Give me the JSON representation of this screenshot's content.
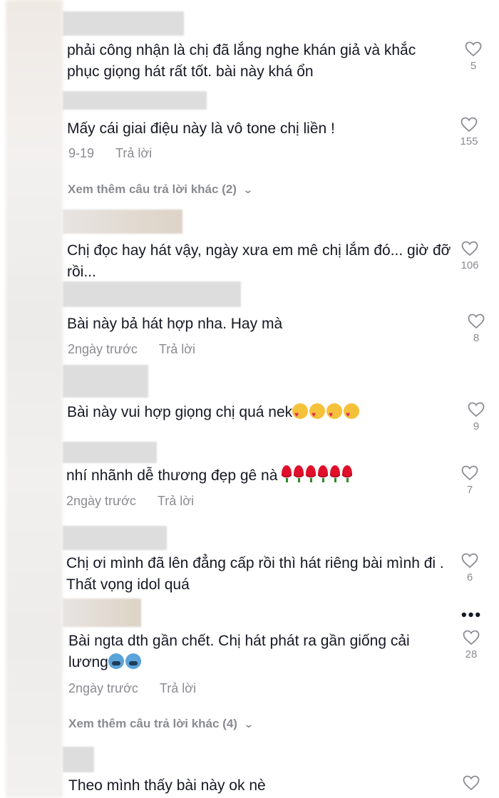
{
  "comments": [
    {
      "text": "phải công nhận là chị đã lắng nghe khán giả và khắc phục giọng hát rất tốt. bài này khá ổn",
      "likes": "5"
    },
    {
      "text": "Mấy cái giai điệu này là vô tone chị liền !",
      "date": "9-19",
      "reply": "Trả lời",
      "likes": "155",
      "more": "Xem thêm câu trả lời khác (2)"
    },
    {
      "text": "Chị đọc hay hát vậy, ngày xưa em mê chị lắm đó... giờ đỡ rồi...",
      "likes": "106"
    },
    {
      "text": "Bài này bả hát hợp nha. Hay mà",
      "date": "2ngày trước",
      "reply": "Trả lời",
      "likes": "8"
    },
    {
      "text": "Bài này vui hợp giọng chị quá nek",
      "likes": "9"
    },
    {
      "text": "nhí nhãnh dễ thương đẹp gê nà",
      "date": "2ngày trước",
      "reply": "Trả lời",
      "likes": "7"
    },
    {
      "text": "Chị ơi mình đã lên đẳng cấp rồi thì hát riêng bài mình đi . Thất vọng idol quá",
      "likes": "6"
    },
    {
      "text": "Bài ngta dth gần chết. Chị hát phát ra gần giống cải lương",
      "date": "2ngày trước",
      "reply": "Trả lời",
      "likes": "28",
      "more": "Xem thêm câu trả lời khác (4)"
    },
    {
      "text": "Theo mình thấy bài này ok nè"
    }
  ],
  "emoji": {
    "c5": "smiling-face-with-hearts",
    "c6": "rose",
    "c8": "cold-face"
  },
  "colors": {
    "text": "#161823",
    "muted": "#8a8b91"
  }
}
